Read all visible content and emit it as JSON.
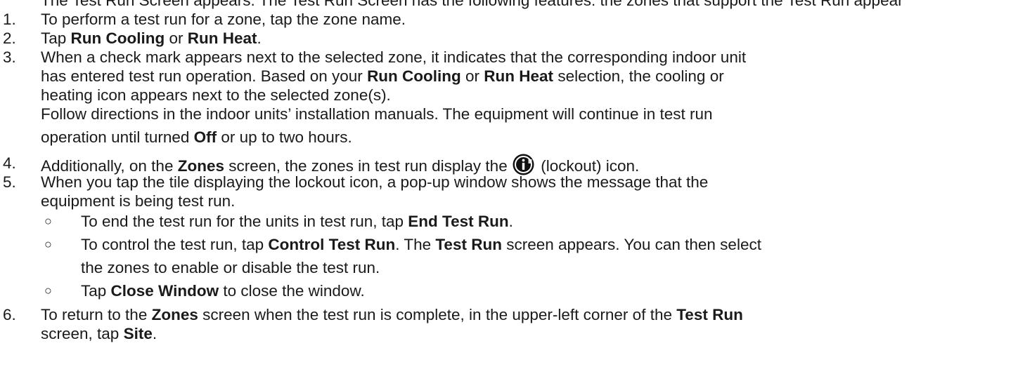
{
  "items": {
    "top_clipped": "The Test Run Screen appears. The Test Run Screen has the following features: the zones that support the Test Run appear",
    "i1": {
      "num": "1.",
      "text": "To perform a test run for a zone, tap the zone name."
    },
    "i2": {
      "num": "2.",
      "t1": "Tap ",
      "b1": "Run Cooling",
      "t2": " or ",
      "b2": "Run Heat",
      "t3": "."
    },
    "i3": {
      "num": "3.",
      "l1": "When a check mark appears next to the selected zone, it indicates that the corresponding indoor unit",
      "l2a": "has entered test run operation. Based on your ",
      "l2b": "Run Cooling",
      "l2c": " or ",
      "l2d": "Run Heat",
      "l2e": " selection, the cooling or",
      "l3": "heating icon appears next to the selected zone(s).",
      "l4": "Follow directions in the indoor units’ installation manuals. The equipment will continue in test run",
      "l5a": "operation until turned ",
      "l5b": "Off",
      "l5c": " or up to two hours."
    },
    "i4": {
      "num": "4.",
      "t1": "Additionally, on the ",
      "b1": "Zones",
      "t2": " screen, the zones in test run display the ",
      "icon": "lockout-icon",
      "t3": " (lockout) icon."
    },
    "i5": {
      "num": "5.",
      "l1": "When you tap the tile displaying the lockout icon, a pop-up window shows the message that the",
      "l2": "equipment is being test run.",
      "bullet": "○",
      "s1a": "To end the test run for the units in test run, tap ",
      "s1b": "End Test Run",
      "s1c": ".",
      "s2a": "To control the test run, tap ",
      "s2b": "Control Test Run",
      "s2c": ". The ",
      "s2d": "Test Run",
      "s2e": " screen appears. You can then select",
      "s2f": "the zones to enable or disable the test run.",
      "s3a": "Tap ",
      "s3b": "Close Window",
      "s3c": " to close the window."
    },
    "i6": {
      "num": "6.",
      "l1a": "To return to the ",
      "l1b": "Zones",
      "l1c": " screen when the test run is complete, in the upper-left corner of the ",
      "l1d": "Test Run",
      "l2a": "screen, tap ",
      "l2b": "Site",
      "l2c": "."
    }
  }
}
